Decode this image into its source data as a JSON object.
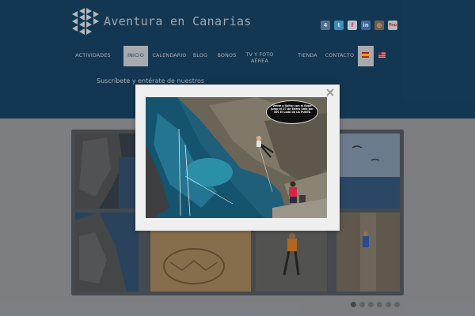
{
  "header": {
    "site_title": "Aventura en Canarias",
    "social_icons": [
      "foursquare-icon",
      "twitter-icon",
      "flickr-icon",
      "linkedin-icon",
      "instagram-icon",
      "youtube-icon"
    ],
    "social_labels": [
      "4",
      "t",
      "f",
      "in",
      "◎",
      "You"
    ]
  },
  "nav": {
    "items": [
      {
        "label": "ACTIVIDADES",
        "active": false
      },
      {
        "label": "INICIO",
        "active": true
      },
      {
        "label": "CALENDARIO",
        "active": false
      },
      {
        "label": "BLOG",
        "active": false
      },
      {
        "label": "BONOS",
        "active": false
      },
      {
        "label_line1": "TV Y FOTO",
        "label_line2": "AÉREA",
        "active": false
      },
      {
        "label": "TIENDA",
        "active": false
      },
      {
        "label": "CONTACTO",
        "active": false
      }
    ],
    "languages": [
      "spanish-flag-icon",
      "english-flag-icon"
    ]
  },
  "subscribe": {
    "text": "Suscríbete y entérate de nuestros"
  },
  "modal": {
    "bubble_text": "Vente a Saltar con el Rope Jump el 27 de Enero Solo por 30€ El Lado de LA PUNTA",
    "close_icon": "close-icon"
  },
  "slider": {
    "dot_count": 6,
    "active_dot": 0
  },
  "colors": {
    "header_bg": "#0f3b5c",
    "page_bg": "#8f9297",
    "nav_active_bg": "#c4c8cd",
    "modal_bg": "#efefef"
  }
}
